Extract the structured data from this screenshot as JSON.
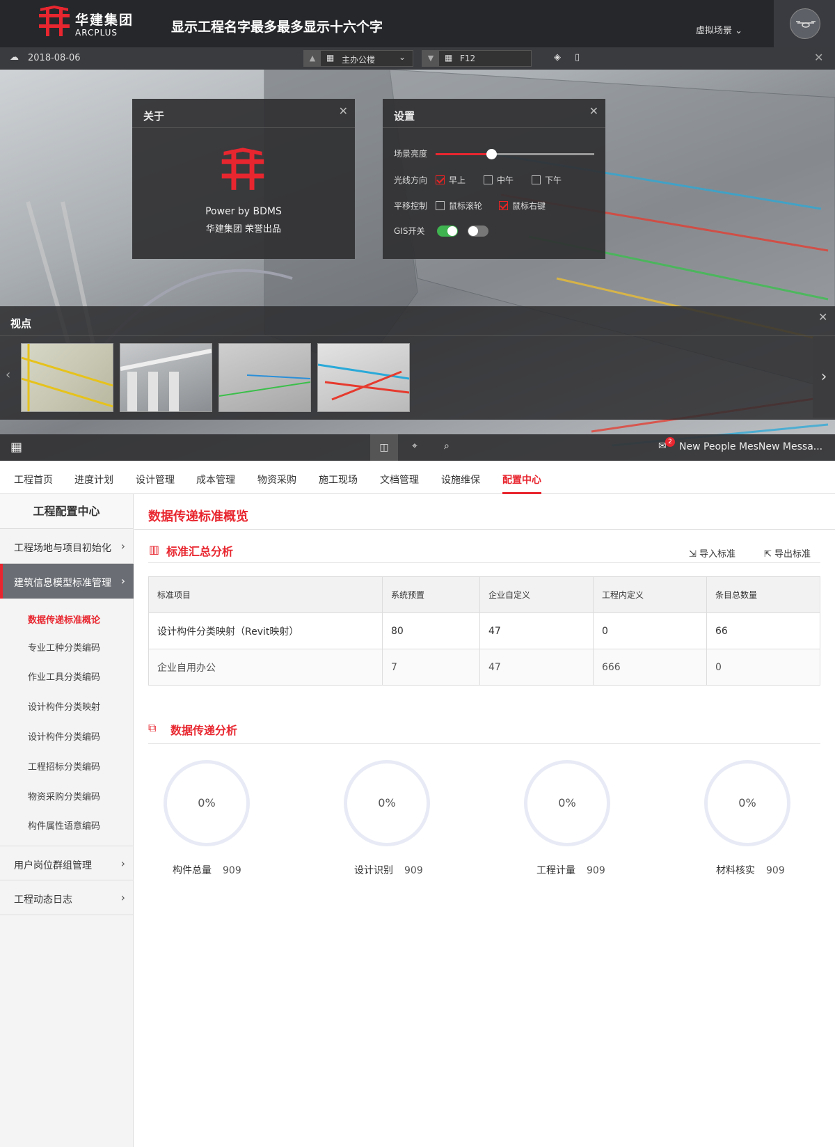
{
  "header": {
    "logo_text": "华建集团",
    "logo_sub": "ARCPLUS",
    "project_title": "显示工程名字最多最多显示十六个字",
    "scene_menu": "虚拟场景"
  },
  "toolbar": {
    "date": "2018-08-06",
    "building": "主办公楼",
    "floor": "F12"
  },
  "about": {
    "title": "关于",
    "power": "Power by BDMS",
    "credit": "华建集团 荣誉出品"
  },
  "settings": {
    "title": "设置",
    "brightness_label": "场景亮度",
    "brightness_level": 0.35,
    "light_label": "光线方向",
    "light_options": [
      "早上",
      "中午",
      "下午"
    ],
    "pan_label": "平移控制",
    "pan_options": [
      "鼠标滚轮",
      "鼠标右键"
    ],
    "gis_label": "GIS开关"
  },
  "viewpoints": {
    "title": "视点"
  },
  "bottom": {
    "badge": "2",
    "message": "New People MesNew Messa..."
  },
  "tabs": [
    "工程首页",
    "进度计划",
    "设计管理",
    "成本管理",
    "物资采购",
    "施工现场",
    "文档管理",
    "设施维保",
    "配置中心"
  ],
  "sidebar": {
    "title": "工程配置中心",
    "items": [
      "工程场地与项目初始化",
      "建筑信息模型标准管理",
      "用户岗位群组管理",
      "工程动态日志"
    ],
    "sub_items": [
      "数据传递标准概论",
      "专业工种分类编码",
      "作业工具分类编码",
      "设计构件分类映射",
      "设计构件分类编码",
      "工程招标分类编码",
      "物资采购分类编码",
      "构件属性语意编码"
    ]
  },
  "main": {
    "title": "数据传递标准概览",
    "section1": "标准汇总分析",
    "import": "导入标准",
    "export": "导出标准",
    "section2": "数据传递分析"
  },
  "table": {
    "headers": [
      "标准项目",
      "系统预置",
      "企业自定义",
      "工程内定义",
      "条目总数量"
    ],
    "rows": [
      [
        "设计构件分类映射（Revit映射）",
        "80",
        "47",
        "0",
        "66"
      ],
      [
        "企业自用办公",
        "7",
        "47",
        "666",
        "0"
      ]
    ]
  },
  "stats": [
    {
      "value": "0%",
      "label": "构件总量",
      "count": "909"
    },
    {
      "value": "0%",
      "label": "设计识别",
      "count": "909"
    },
    {
      "value": "0%",
      "label": "工程计量",
      "count": "909"
    },
    {
      "value": "0%",
      "label": "材料核实",
      "count": "909"
    }
  ]
}
